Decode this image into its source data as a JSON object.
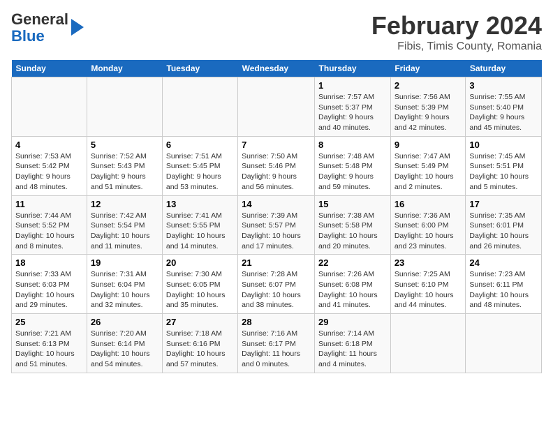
{
  "header": {
    "logo_line1": "General",
    "logo_line2": "Blue",
    "main_title": "February 2024",
    "sub_title": "Fibis, Timis County, Romania"
  },
  "days_of_week": [
    "Sunday",
    "Monday",
    "Tuesday",
    "Wednesday",
    "Thursday",
    "Friday",
    "Saturday"
  ],
  "weeks": [
    [
      {
        "day": "",
        "info": ""
      },
      {
        "day": "",
        "info": ""
      },
      {
        "day": "",
        "info": ""
      },
      {
        "day": "",
        "info": ""
      },
      {
        "day": "1",
        "info": "Sunrise: 7:57 AM\nSunset: 5:37 PM\nDaylight: 9 hours\nand 40 minutes."
      },
      {
        "day": "2",
        "info": "Sunrise: 7:56 AM\nSunset: 5:39 PM\nDaylight: 9 hours\nand 42 minutes."
      },
      {
        "day": "3",
        "info": "Sunrise: 7:55 AM\nSunset: 5:40 PM\nDaylight: 9 hours\nand 45 minutes."
      }
    ],
    [
      {
        "day": "4",
        "info": "Sunrise: 7:53 AM\nSunset: 5:42 PM\nDaylight: 9 hours\nand 48 minutes."
      },
      {
        "day": "5",
        "info": "Sunrise: 7:52 AM\nSunset: 5:43 PM\nDaylight: 9 hours\nand 51 minutes."
      },
      {
        "day": "6",
        "info": "Sunrise: 7:51 AM\nSunset: 5:45 PM\nDaylight: 9 hours\nand 53 minutes."
      },
      {
        "day": "7",
        "info": "Sunrise: 7:50 AM\nSunset: 5:46 PM\nDaylight: 9 hours\nand 56 minutes."
      },
      {
        "day": "8",
        "info": "Sunrise: 7:48 AM\nSunset: 5:48 PM\nDaylight: 9 hours\nand 59 minutes."
      },
      {
        "day": "9",
        "info": "Sunrise: 7:47 AM\nSunset: 5:49 PM\nDaylight: 10 hours\nand 2 minutes."
      },
      {
        "day": "10",
        "info": "Sunrise: 7:45 AM\nSunset: 5:51 PM\nDaylight: 10 hours\nand 5 minutes."
      }
    ],
    [
      {
        "day": "11",
        "info": "Sunrise: 7:44 AM\nSunset: 5:52 PM\nDaylight: 10 hours\nand 8 minutes."
      },
      {
        "day": "12",
        "info": "Sunrise: 7:42 AM\nSunset: 5:54 PM\nDaylight: 10 hours\nand 11 minutes."
      },
      {
        "day": "13",
        "info": "Sunrise: 7:41 AM\nSunset: 5:55 PM\nDaylight: 10 hours\nand 14 minutes."
      },
      {
        "day": "14",
        "info": "Sunrise: 7:39 AM\nSunset: 5:57 PM\nDaylight: 10 hours\nand 17 minutes."
      },
      {
        "day": "15",
        "info": "Sunrise: 7:38 AM\nSunset: 5:58 PM\nDaylight: 10 hours\nand 20 minutes."
      },
      {
        "day": "16",
        "info": "Sunrise: 7:36 AM\nSunset: 6:00 PM\nDaylight: 10 hours\nand 23 minutes."
      },
      {
        "day": "17",
        "info": "Sunrise: 7:35 AM\nSunset: 6:01 PM\nDaylight: 10 hours\nand 26 minutes."
      }
    ],
    [
      {
        "day": "18",
        "info": "Sunrise: 7:33 AM\nSunset: 6:03 PM\nDaylight: 10 hours\nand 29 minutes."
      },
      {
        "day": "19",
        "info": "Sunrise: 7:31 AM\nSunset: 6:04 PM\nDaylight: 10 hours\nand 32 minutes."
      },
      {
        "day": "20",
        "info": "Sunrise: 7:30 AM\nSunset: 6:05 PM\nDaylight: 10 hours\nand 35 minutes."
      },
      {
        "day": "21",
        "info": "Sunrise: 7:28 AM\nSunset: 6:07 PM\nDaylight: 10 hours\nand 38 minutes."
      },
      {
        "day": "22",
        "info": "Sunrise: 7:26 AM\nSunset: 6:08 PM\nDaylight: 10 hours\nand 41 minutes."
      },
      {
        "day": "23",
        "info": "Sunrise: 7:25 AM\nSunset: 6:10 PM\nDaylight: 10 hours\nand 44 minutes."
      },
      {
        "day": "24",
        "info": "Sunrise: 7:23 AM\nSunset: 6:11 PM\nDaylight: 10 hours\nand 48 minutes."
      }
    ],
    [
      {
        "day": "25",
        "info": "Sunrise: 7:21 AM\nSunset: 6:13 PM\nDaylight: 10 hours\nand 51 minutes."
      },
      {
        "day": "26",
        "info": "Sunrise: 7:20 AM\nSunset: 6:14 PM\nDaylight: 10 hours\nand 54 minutes."
      },
      {
        "day": "27",
        "info": "Sunrise: 7:18 AM\nSunset: 6:16 PM\nDaylight: 10 hours\nand 57 minutes."
      },
      {
        "day": "28",
        "info": "Sunrise: 7:16 AM\nSunset: 6:17 PM\nDaylight: 11 hours\nand 0 minutes."
      },
      {
        "day": "29",
        "info": "Sunrise: 7:14 AM\nSunset: 6:18 PM\nDaylight: 11 hours\nand 4 minutes."
      },
      {
        "day": "",
        "info": ""
      },
      {
        "day": "",
        "info": ""
      }
    ]
  ]
}
